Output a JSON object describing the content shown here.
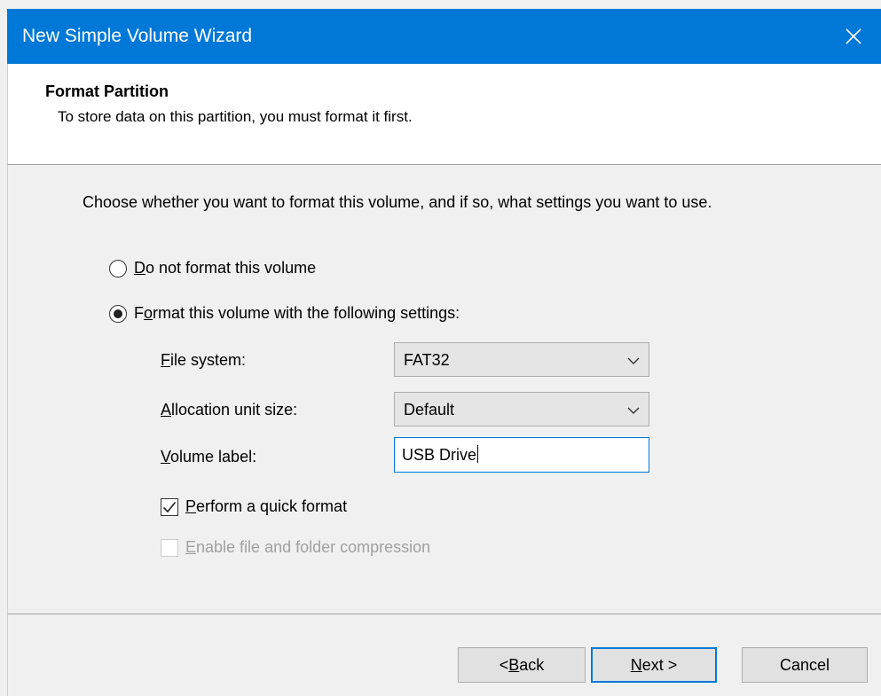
{
  "window": {
    "title": "New Simple Volume Wizard",
    "accent_color": "#0078d7"
  },
  "header": {
    "title": "Format Partition",
    "subtitle": "To store data on this partition, you must format it first."
  },
  "main": {
    "intro": "Choose whether you want to format this volume, and if so, what settings you want to use.",
    "options": {
      "no_format": {
        "mnemonic": "D",
        "rest": "o not format this volume",
        "selected": false
      },
      "format": {
        "pre": "F",
        "mnemonic": "o",
        "rest": "rmat this volume with the following settings:",
        "selected": true
      }
    },
    "file_system": {
      "mnemonic": "F",
      "label_rest": "ile system:",
      "value": "FAT32"
    },
    "allocation": {
      "mnemonic": "A",
      "label_rest": "llocation unit size:",
      "value": "Default"
    },
    "volume_label": {
      "mnemonic": "V",
      "label_rest": "olume label:",
      "value": "USB Drive"
    },
    "quick_format": {
      "mnemonic": "P",
      "label_rest": "erform a quick format",
      "checked": true
    },
    "compression": {
      "mnemonic": "E",
      "label_rest": "nable file and folder compression",
      "checked": false,
      "enabled": false
    }
  },
  "footer": {
    "back": {
      "pre": "< ",
      "mnemonic": "B",
      "rest": "ack"
    },
    "next": {
      "mnemonic": "N",
      "rest": "ext >"
    },
    "cancel": "Cancel"
  }
}
